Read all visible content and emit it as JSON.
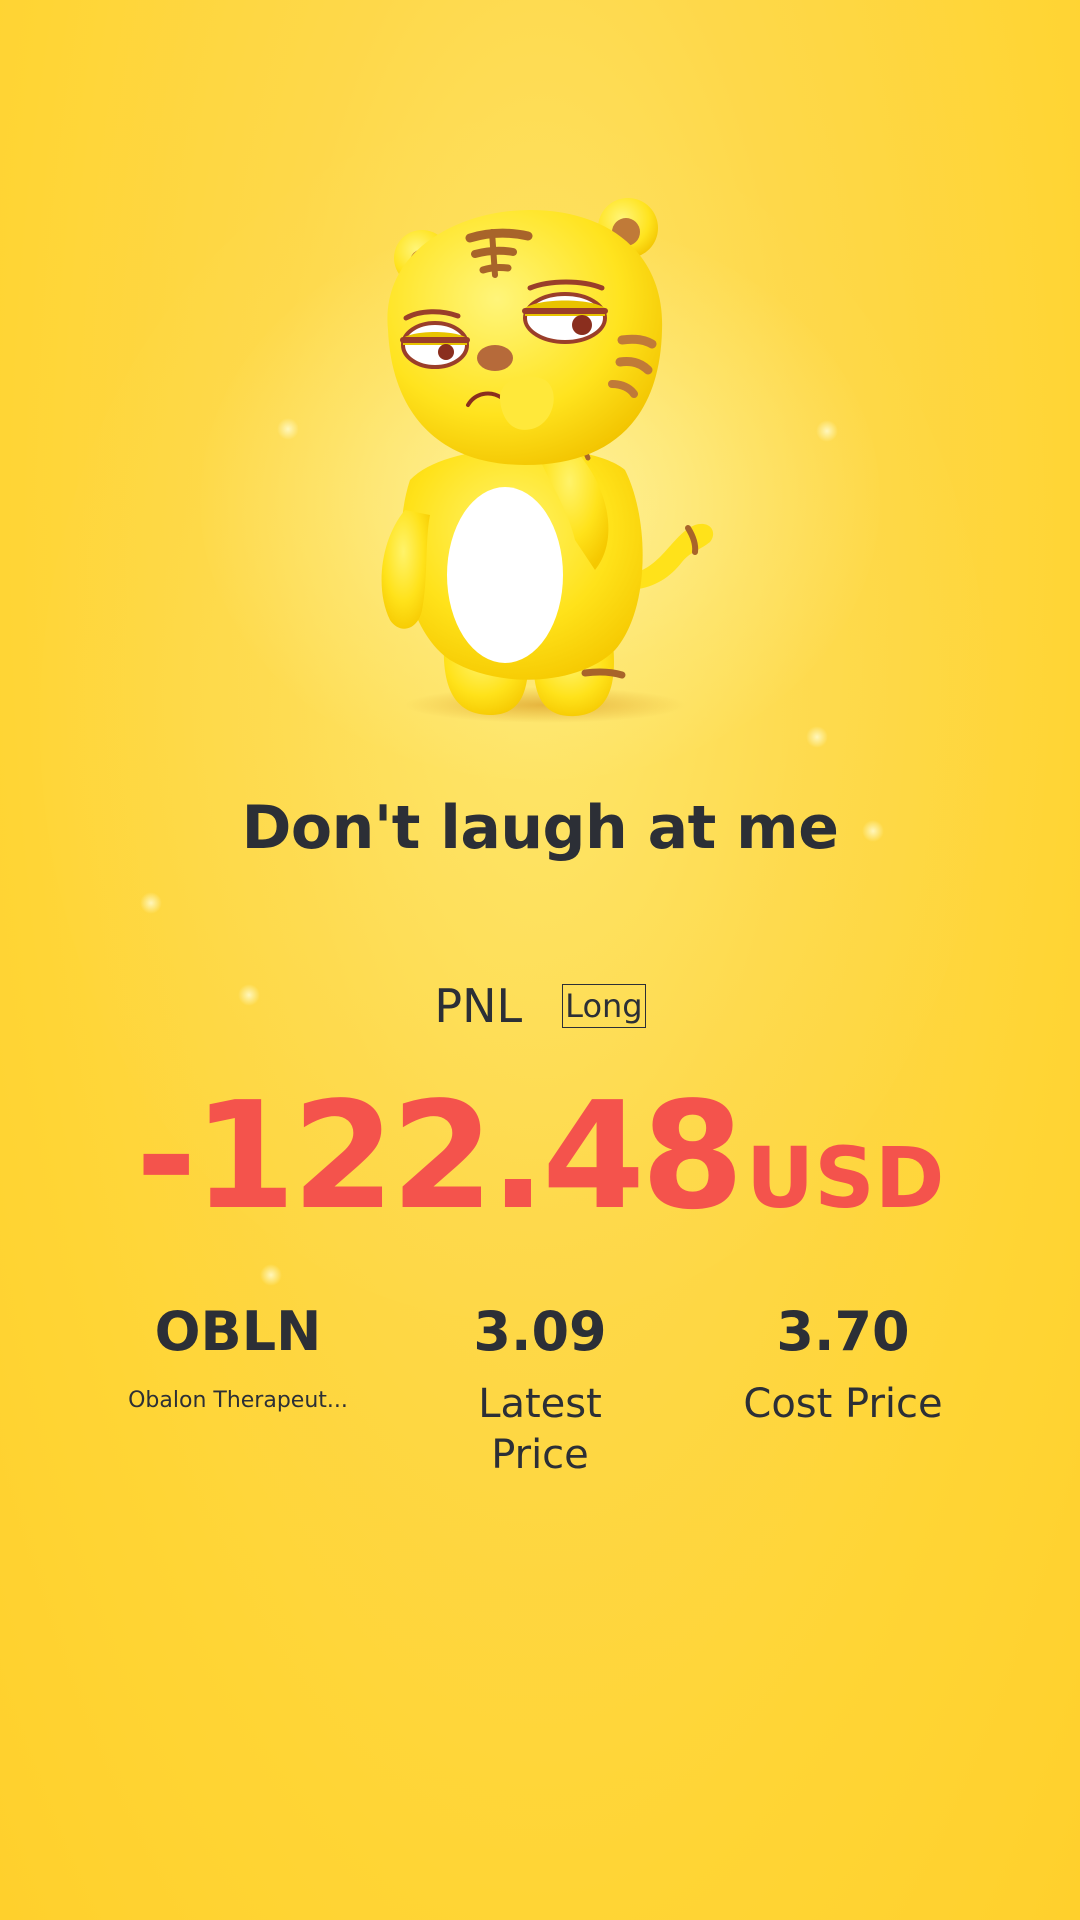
{
  "headline": "Don't laugh at me",
  "pnl": {
    "label": "PNL",
    "position_side": "Long",
    "value": "-122.48",
    "unit": "USD"
  },
  "stats": {
    "symbol": "OBLN",
    "company_name": "Obalon Therapeut...",
    "latest_price": "3.09",
    "latest_price_label": "Latest Price",
    "cost_price": "3.70",
    "cost_price_label": "Cost Price"
  },
  "mascot": {
    "icon": "tiger-mascot-icon",
    "expression": "annoyed"
  },
  "colors": {
    "background": "#ffd535",
    "text": "#2c2f36",
    "loss": "#f4534c"
  }
}
